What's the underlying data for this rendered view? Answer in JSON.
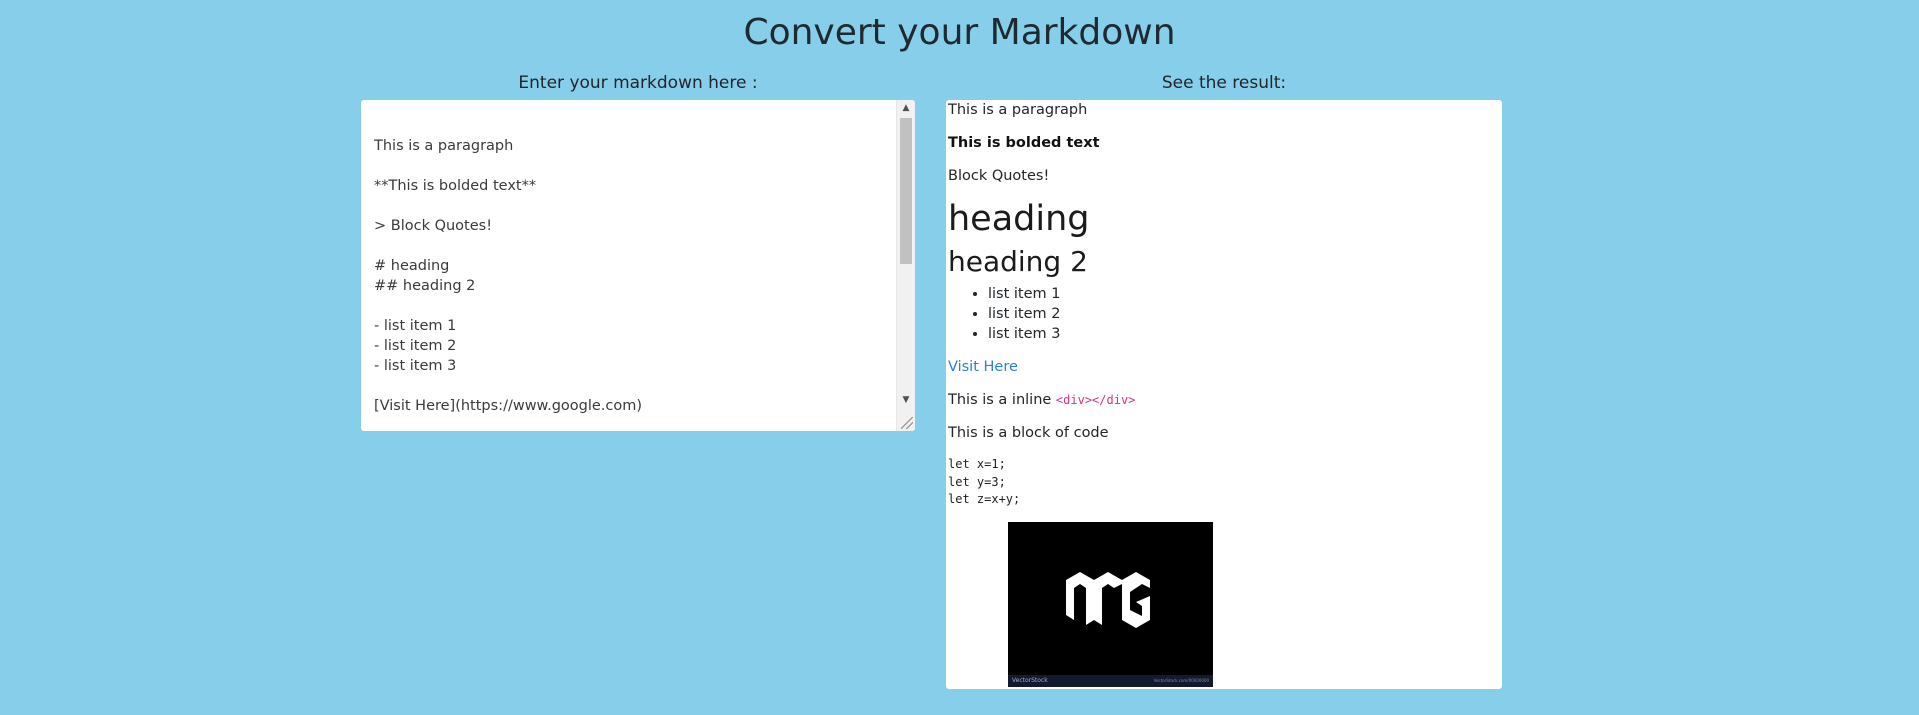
{
  "header": {
    "title": "Convert your Markdown"
  },
  "editor": {
    "label": "Enter your markdown here :",
    "content": "\nThis is a paragraph\n\n**This is bolded text**\n\n> Block Quotes!\n\n# heading\n## heading 2\n\n- list item 1\n- list item 2\n- list item 3\n\n[Visit Here](https://www.google.com)\n\nThis is a inline `<div></div>`"
  },
  "preview": {
    "label": "See the result:",
    "paragraph": "This is a paragraph",
    "bold": "This is bolded text",
    "blockquote": "Block Quotes!",
    "heading1": "heading",
    "heading2": "heading 2",
    "list_items": [
      "list item 1",
      "list item 2",
      "list item 3"
    ],
    "link_text": "Visit Here",
    "inline_text": "This is a inline ",
    "inline_code": "<div></div>",
    "code_intro": "This is a block of code",
    "code_block": "let x=1;\nlet y=3;\nlet z=x+y;",
    "image": {
      "watermark": "VectorStock",
      "watermark_right": "VectorStock.com/00000000",
      "colors": {
        "bg": "#000000",
        "logo": "#ffffff"
      }
    }
  }
}
